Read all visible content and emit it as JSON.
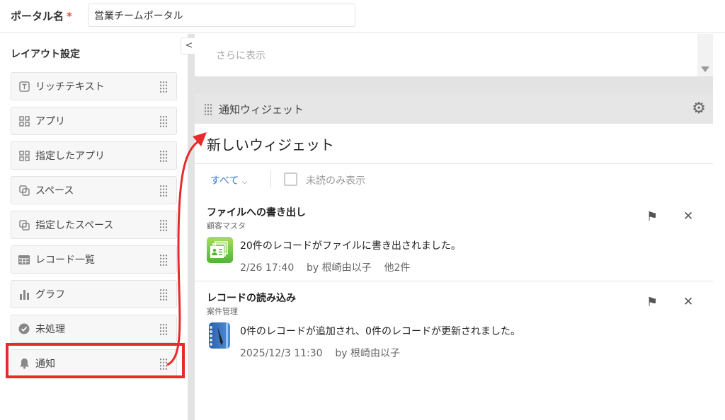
{
  "portal": {
    "label": "ポータル名",
    "required_mark": "*",
    "value": "営業チームポータル"
  },
  "layout": {
    "title": "レイアウト設定",
    "items": [
      {
        "label": "リッチテキスト",
        "icon": "text-icon"
      },
      {
        "label": "アプリ",
        "icon": "apps-icon"
      },
      {
        "label": "指定したアプリ",
        "icon": "apps-icon"
      },
      {
        "label": "スペース",
        "icon": "space-icon"
      },
      {
        "label": "指定したスペース",
        "icon": "space-icon"
      },
      {
        "label": "レコード一覧",
        "icon": "table-icon"
      },
      {
        "label": "グラフ",
        "icon": "chart-icon"
      },
      {
        "label": "未処理",
        "icon": "check-icon"
      },
      {
        "label": "通知",
        "icon": "bell-icon"
      }
    ]
  },
  "preview": {
    "more": "さらに表示"
  },
  "widget": {
    "header": "通知ウィジェット",
    "name": "新しいウィジェット",
    "filter": "すべて",
    "unread_only": "未読のみ表示",
    "notifications": [
      {
        "title": "ファイルへの書き出し",
        "app": "顧客マスタ",
        "message": "20件のレコードがファイルに書き出されました。",
        "meta": "2/26 17:40    by 根崎由以子    他2件"
      },
      {
        "title": "レコードの読み込み",
        "app": "案件管理",
        "message": "0件のレコードが追加され、0件のレコードが更新されました。",
        "meta": "2025/12/3 11:30    by 根崎由以子"
      }
    ]
  },
  "colors": {
    "highlight": "#e52b2b",
    "link": "#3b7dc8"
  }
}
